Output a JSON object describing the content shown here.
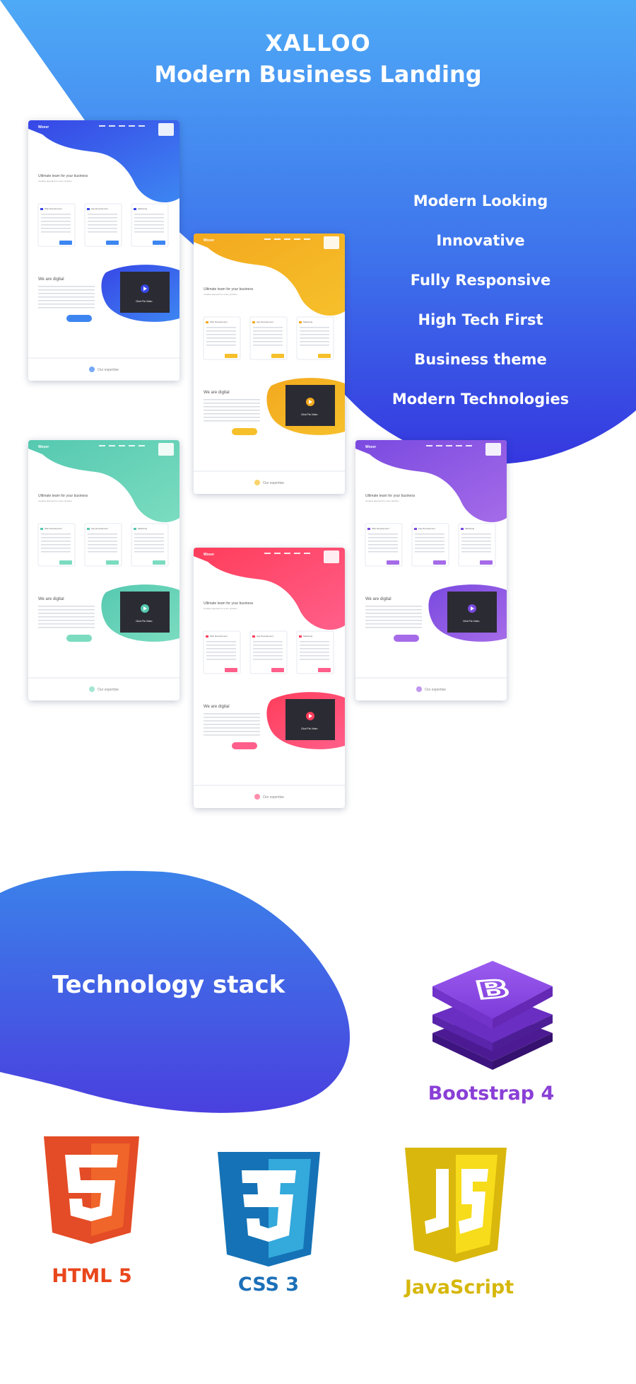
{
  "hero": {
    "title": "XALLOO",
    "subtitle": "Modern Business Landing"
  },
  "features": [
    "Modern Looking",
    "Innovative",
    "Fully Responsive",
    "High Tech First",
    "Business theme",
    "Modern Technologies"
  ],
  "previews": [
    {
      "id": "blue",
      "accent": "#3d86f2",
      "accent2": "#3746e6"
    },
    {
      "id": "yellow",
      "accent": "#f6c02b",
      "accent2": "#f3a91e"
    },
    {
      "id": "teal",
      "accent": "#7bdcc0",
      "accent2": "#55c9b0"
    },
    {
      "id": "purple",
      "accent": "#a56be8",
      "accent2": "#7a4ae0"
    },
    {
      "id": "pink",
      "accent": "#ff5f8a",
      "accent2": "#ff3d5b"
    }
  ],
  "preview_text": {
    "brand": "Woxer",
    "headline": "Ultimate team for your",
    "headline_accent": "business",
    "tagline": "Creative approach to every problem",
    "services": [
      "Web Development",
      "App Development",
      "Marketing"
    ],
    "service_button": "More",
    "section_title": "We are digital",
    "video_label": "Click Pla Video",
    "cta": "More Expertise",
    "footer": "Our expertise"
  },
  "tech": {
    "title": "Technology stack",
    "items": [
      {
        "name": "Bootstrap 4",
        "color": "#8a3fd6",
        "icon": "bootstrap-icon"
      },
      {
        "name": "HTML 5",
        "color": "#e9461c",
        "icon": "html5-icon"
      },
      {
        "name": "CSS 3",
        "color": "#1c6fb8",
        "icon": "css3-icon"
      },
      {
        "name": "JavaScript",
        "color": "#d6b70b",
        "icon": "javascript-icon"
      }
    ]
  },
  "colors": {
    "hero_top": "#4daaf5",
    "hero_bottom": "#3538e0",
    "tech_blob_top": "#3a7de8",
    "tech_blob_bottom": "#4842e0"
  }
}
